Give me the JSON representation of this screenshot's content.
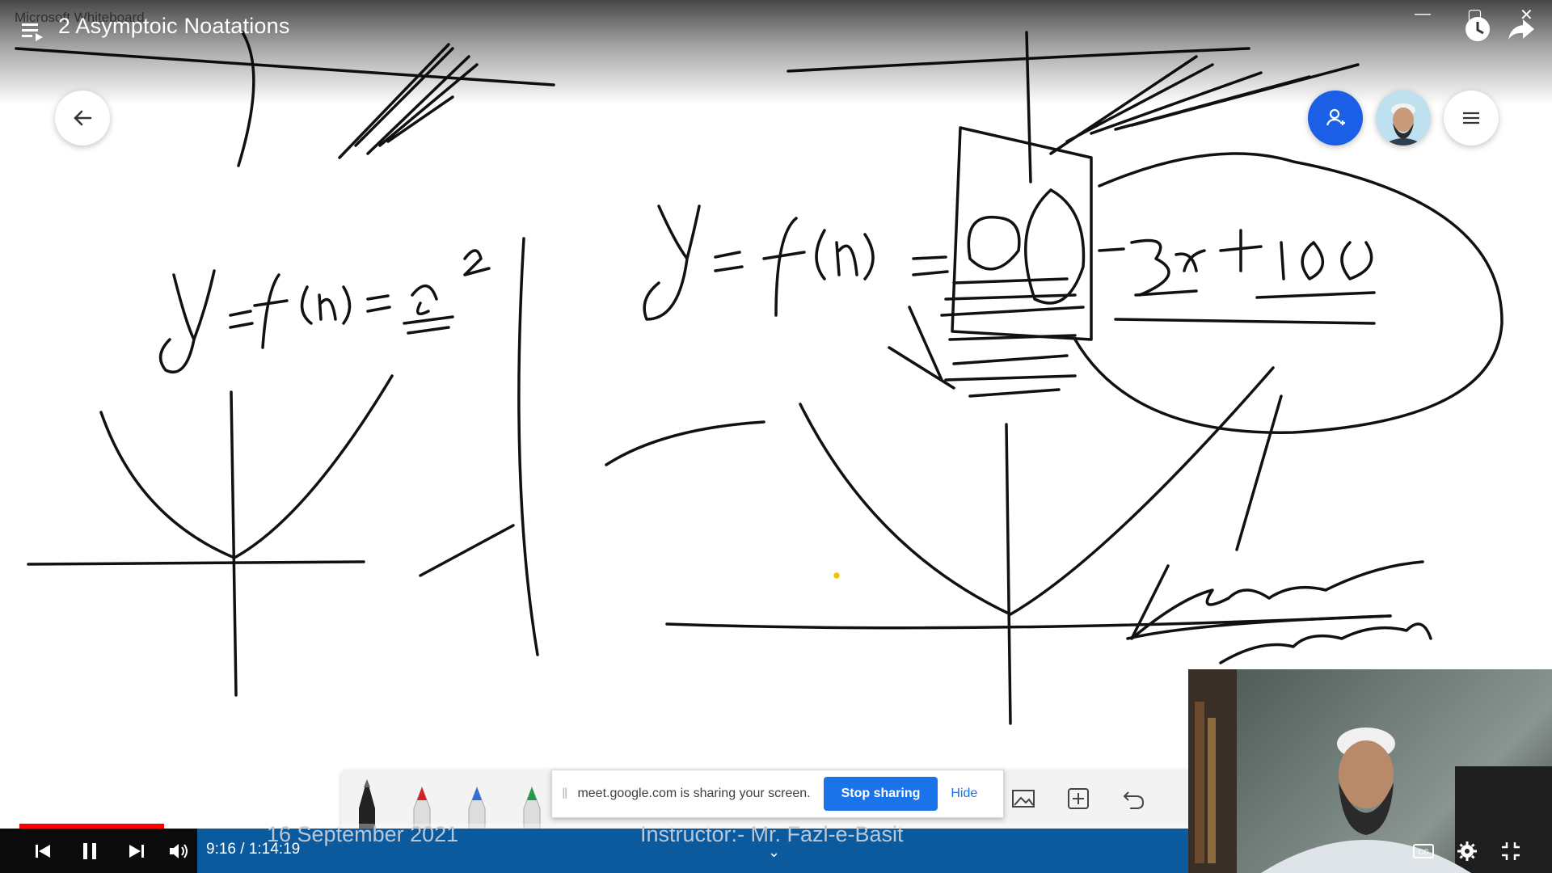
{
  "app": {
    "name": "Microsoft Whiteboard"
  },
  "video": {
    "title": "2 Asymptoic Noatations",
    "current_time": "9:16 / 1:14:19",
    "progress_fraction": 0.124
  },
  "whiteboard": {
    "toolbar": {
      "pens": [
        "black-pen-icon",
        "red-pen-icon",
        "blue-pen-icon",
        "green-pen-icon"
      ]
    }
  },
  "share_notice": {
    "message": "meet.google.com is sharing your screen.",
    "stop_label": "Stop sharing",
    "hide_label": "Hide"
  },
  "banner": {
    "date": "16 September 2021",
    "instructor": "Instructor:- Mr. Fazl-e-Basit"
  },
  "icons": {
    "playlist": "playlist-icon",
    "watch_later": "clock-icon",
    "share": "share-arrow-icon",
    "back": "arrow-left-icon",
    "people": "person-add-icon",
    "menu": "hamburger-icon",
    "prev": "skip-previous-icon",
    "pause": "pause-icon",
    "next": "skip-next-icon",
    "volume": "volume-icon",
    "captions": "cc-icon",
    "settings": "gear-icon",
    "exit_fullscreen": "exit-fullscreen-icon"
  },
  "colors": {
    "progress": "#ff0000",
    "stop_button": "#1a73e8",
    "people_button": "#1a5fe6",
    "banner": "#0c5a9e"
  }
}
